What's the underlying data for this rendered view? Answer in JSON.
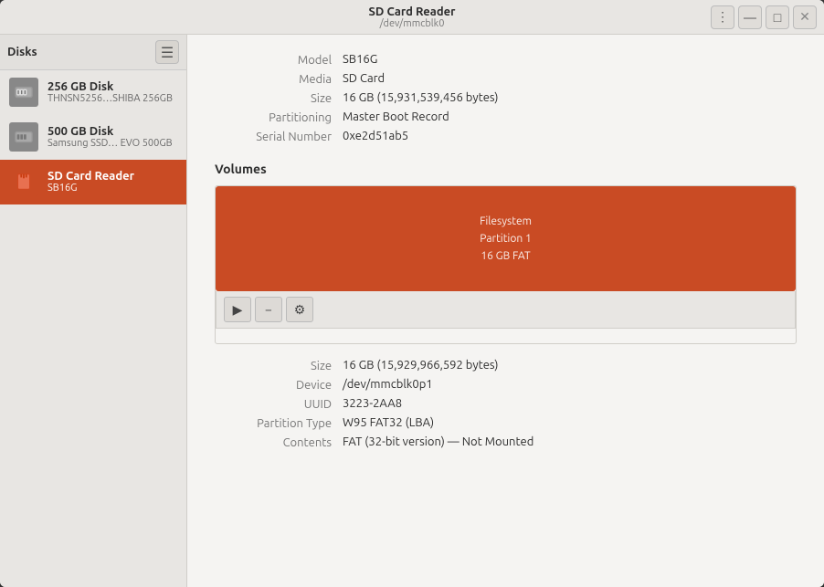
{
  "titlebar": {
    "title": "SD Card Reader",
    "subtitle": "/dev/mmcblk0",
    "menu_label": "⋮",
    "minimize_label": "—",
    "maximize_label": "□",
    "close_label": "✕"
  },
  "sidebar": {
    "title": "Disks",
    "menu_label": "☰",
    "items": [
      {
        "name": "256 GB Disk",
        "sub": "THNSN5256…SHIBA 256GB",
        "type": "ssd",
        "active": false
      },
      {
        "name": "500 GB Disk",
        "sub": "Samsung SSD… EVO 500GB",
        "type": "ssd",
        "active": false
      },
      {
        "name": "SD Card Reader",
        "sub": "SB16G",
        "type": "sdcard",
        "active": true
      }
    ]
  },
  "disk_info": {
    "model_label": "Model",
    "model_value": "SB16G",
    "media_label": "Media",
    "media_value": "SD Card",
    "size_label": "Size",
    "size_value": "16 GB (15,931,539,456 bytes)",
    "partitioning_label": "Partitioning",
    "partitioning_value": "Master Boot Record",
    "serial_label": "Serial Number",
    "serial_value": "0xe2d51ab5"
  },
  "volumes": {
    "section_title": "Volumes",
    "partition_label": "Filesystem\nPartition 1\n16 GB FAT",
    "partition_line1": "Filesystem",
    "partition_line2": "Partition 1",
    "partition_line3": "16 GB FAT",
    "toolbar": {
      "mount_icon": "▶",
      "remove_icon": "−",
      "settings_icon": "⚙"
    }
  },
  "partition_info": {
    "size_label": "Size",
    "size_value": "16 GB (15,929,966,592 bytes)",
    "device_label": "Device",
    "device_value": "/dev/mmcblk0p1",
    "uuid_label": "UUID",
    "uuid_value": "3223-2AA8",
    "partition_type_label": "Partition Type",
    "partition_type_value": "W95 FAT32 (LBA)",
    "contents_label": "Contents",
    "contents_value": "FAT (32-bit version) — Not Mounted"
  }
}
